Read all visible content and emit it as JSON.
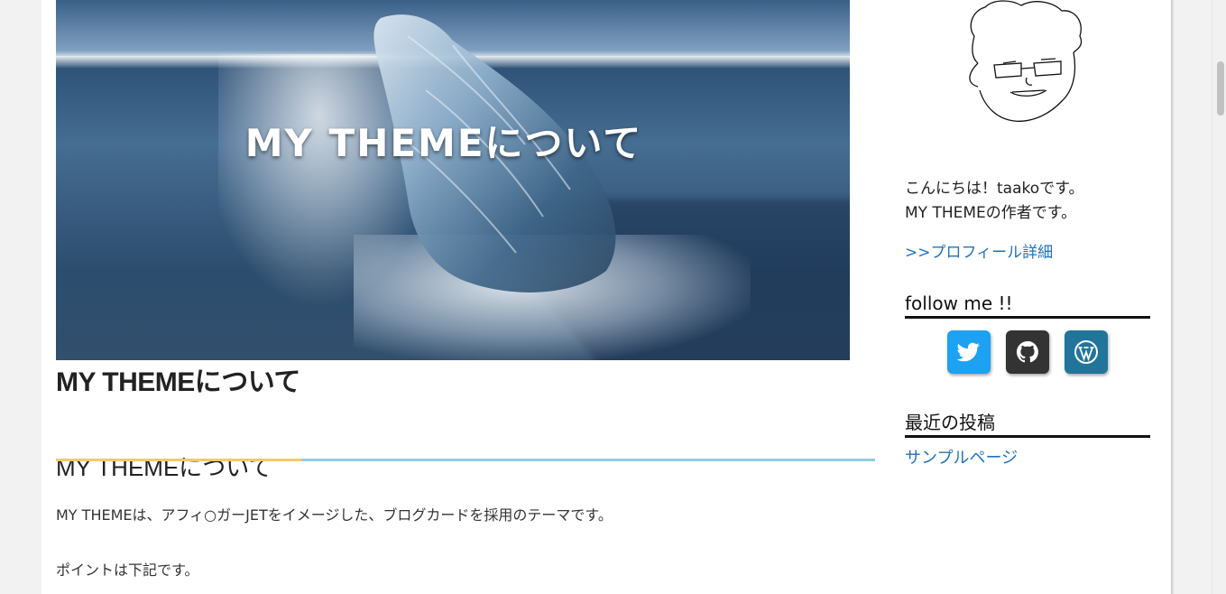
{
  "hero": {
    "overlay_text": "MY THEMEについて"
  },
  "article": {
    "title": "MY THEMEについて",
    "h2": "MY THEMEについて",
    "paragraphs": [
      "MY THEMEは、アフィ○ガーJETをイメージした、ブログカードを採用のテーマです。",
      "ポイントは下記です。"
    ]
  },
  "sidebar": {
    "intro_lines": [
      "こんにちは！taakoです。",
      "MY THEMEの作者です。"
    ],
    "profile_link": ">>プロフィール詳細",
    "follow_title": "follow me !!",
    "sns": [
      {
        "icon": "twitter-icon",
        "color": "#1da1f2"
      },
      {
        "icon": "github-icon",
        "color": "#333333"
      },
      {
        "icon": "wordpress-icon",
        "color": "#21759b"
      }
    ],
    "recent_title": "最近の投稿",
    "recent_posts": [
      "サンプルページ"
    ]
  },
  "colors": {
    "link": "#1e73be",
    "h2_underline": "#90cde0",
    "h2_accent": "#f6c96a"
  }
}
